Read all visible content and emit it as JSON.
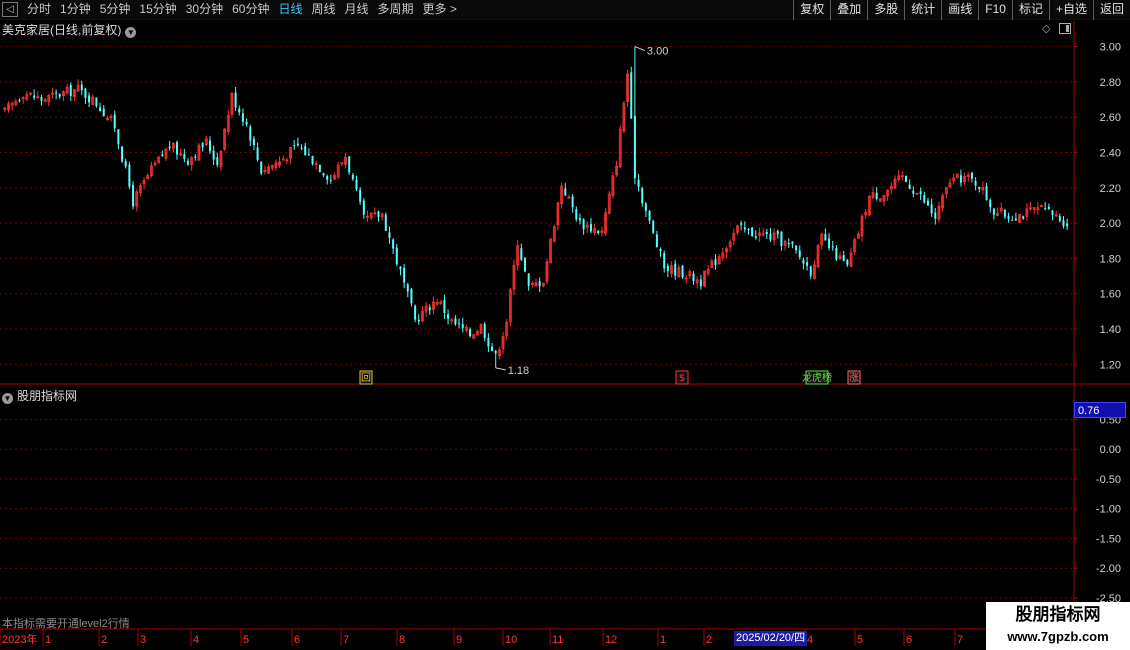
{
  "toolbar": {
    "periods": [
      "分时",
      "1分钟",
      "5分钟",
      "15分钟",
      "30分钟",
      "60分钟",
      "日线",
      "周线",
      "月线",
      "多周期",
      "更多 >"
    ],
    "active_period": "日线",
    "right_buttons": [
      "复权",
      "叠加",
      "多股",
      "统计",
      "画线",
      "F10",
      "标记",
      "+自选",
      "返回"
    ]
  },
  "main_chart": {
    "title": "美克家居(日线,前复权)",
    "price_axis": [
      "3.00",
      "2.80",
      "2.60",
      "2.40",
      "2.20",
      "2.00",
      "1.80",
      "1.60",
      "1.40",
      "1.20"
    ],
    "high_label": "3.00",
    "low_label": "1.18",
    "event_markers": [
      {
        "text": "回",
        "color": "#e8c23a"
      },
      {
        "text": "$",
        "color": "#ff3030"
      },
      {
        "text": "龙虎榜",
        "color": "#66dd44"
      },
      {
        "text": "涨",
        "color": "#ff6666"
      }
    ]
  },
  "indicator": {
    "title": "股朋指标网",
    "value": "0.76",
    "axis": [
      "0.50",
      "0.00",
      "-0.50",
      "-1.00",
      "-1.50",
      "-2.00",
      "-2.50"
    ],
    "note": "本指标需要开通level2行情"
  },
  "date_axis": {
    "labels": [
      "2023年",
      "1",
      "2",
      "3",
      "4",
      "5",
      "6",
      "7",
      "8",
      "9",
      "10",
      "11",
      "12",
      "1",
      "2",
      "3",
      "4",
      "5",
      "6",
      "7"
    ],
    "cursor_date": "2025/02/20/四"
  },
  "watermark": {
    "line1": "股朋指标网",
    "line2": "www.7gpzb.com"
  },
  "colors": {
    "up": "#ff3232",
    "down": "#54ffff",
    "grid": "#7a0000",
    "axis_line": "#b00000",
    "active": "#3ec7ff"
  },
  "chart_data": {
    "type": "candlestick",
    "ylim": [
      1.1,
      3.06
    ],
    "close_path": [
      [
        0,
        2.63
      ],
      [
        5,
        2.74
      ],
      [
        10,
        2.7
      ],
      [
        15,
        2.73
      ],
      [
        20,
        2.76
      ],
      [
        25,
        2.68
      ],
      [
        30,
        2.55
      ],
      [
        35,
        2.12
      ],
      [
        40,
        2.3
      ],
      [
        45,
        2.44
      ],
      [
        50,
        2.36
      ],
      [
        55,
        2.46
      ],
      [
        58,
        2.34
      ],
      [
        62,
        2.72
      ],
      [
        66,
        2.56
      ],
      [
        70,
        2.3
      ],
      [
        75,
        2.35
      ],
      [
        80,
        2.44
      ],
      [
        85,
        2.34
      ],
      [
        89,
        2.25
      ],
      [
        93,
        2.38
      ],
      [
        98,
        2.02
      ],
      [
        103,
        2.05
      ],
      [
        108,
        1.72
      ],
      [
        112,
        1.45
      ],
      [
        118,
        1.57
      ],
      [
        122,
        1.44
      ],
      [
        127,
        1.37
      ],
      [
        130,
        1.42
      ],
      [
        134,
        1.24
      ],
      [
        137,
        1.45
      ],
      [
        140,
        1.9
      ],
      [
        143,
        1.63
      ],
      [
        147,
        1.68
      ],
      [
        152,
        2.22
      ],
      [
        157,
        2.0
      ],
      [
        163,
        1.95
      ],
      [
        167,
        2.35
      ],
      [
        170,
        2.85
      ],
      [
        172,
        2.28
      ],
      [
        176,
        2.0
      ],
      [
        180,
        1.75
      ],
      [
        185,
        1.72
      ],
      [
        190,
        1.67
      ],
      [
        195,
        1.82
      ],
      [
        200,
        1.97
      ],
      [
        205,
        1.94
      ],
      [
        210,
        1.92
      ],
      [
        215,
        1.86
      ],
      [
        220,
        1.73
      ],
      [
        223,
        1.91
      ],
      [
        226,
        1.84
      ],
      [
        230,
        1.75
      ],
      [
        233,
        1.95
      ],
      [
        236,
        2.15
      ],
      [
        240,
        2.17
      ],
      [
        245,
        2.26
      ],
      [
        250,
        2.15
      ],
      [
        254,
        2.03
      ],
      [
        258,
        2.24
      ],
      [
        262,
        2.26
      ],
      [
        266,
        2.22
      ],
      [
        270,
        2.07
      ],
      [
        274,
        2.04
      ],
      [
        278,
        2.05
      ],
      [
        282,
        2.08
      ],
      [
        286,
        2.05
      ],
      [
        290,
        2.0
      ]
    ],
    "high_point": {
      "index": 172,
      "value": 3.0
    },
    "low_point": {
      "index": 134,
      "value": 1.18
    },
    "bar_count": 291
  }
}
